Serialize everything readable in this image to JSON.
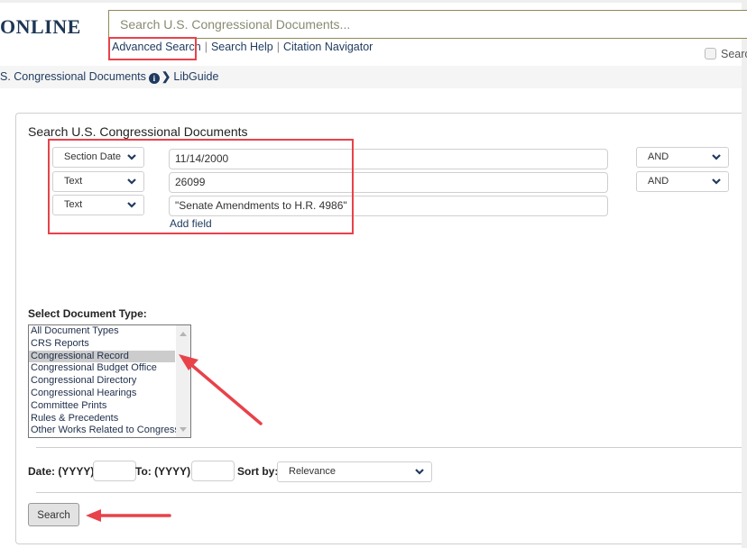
{
  "header": {
    "logo_text": "ONLINE",
    "search": {
      "placeholder": "Search U.S. Congressional Documents...",
      "value": ""
    },
    "links": {
      "advanced_search": "Advanced Search",
      "separator": "|",
      "search_help": "Search Help",
      "citation_navigator": "Citation Navigator"
    },
    "search_all_checkbox_label": "Search",
    "search_all_checked": false
  },
  "breadcrumb": {
    "collection": "S. Congressional Documents",
    "info_icon": "info-circle-icon",
    "separator_icon": "chevron-right-icon",
    "libguide": "LibGuide"
  },
  "advanced_search": {
    "title": "Search U.S. Congressional Documents",
    "rows": [
      {
        "field": "Section Date",
        "value": "11/14/2000",
        "operator": "AND"
      },
      {
        "field": "Text",
        "value": "26099",
        "operator": "AND"
      },
      {
        "field": "Text",
        "value": "\"Senate Amendments to H.R. 4986\"",
        "operator": null
      }
    ],
    "add_field_label": "Add field"
  },
  "document_type": {
    "label": "Select Document Type:",
    "options": [
      "All Document Types",
      "CRS Reports",
      "Congressional Record",
      "Congressional Budget Office",
      "Congressional Directory",
      "Congressional Hearings",
      "Committee Prints",
      "Rules & Precedents",
      "Other Works Related to Congress"
    ],
    "selected": "Congressional Record"
  },
  "date_filter": {
    "from_label": "Date: (YYYY)",
    "from_value": "",
    "to_label": "To: (YYYY)",
    "to_value": "",
    "sort_label": "Sort by:",
    "sort_value": "Relevance"
  },
  "search_button_label": "Search",
  "annotation_color": "#e8424a"
}
